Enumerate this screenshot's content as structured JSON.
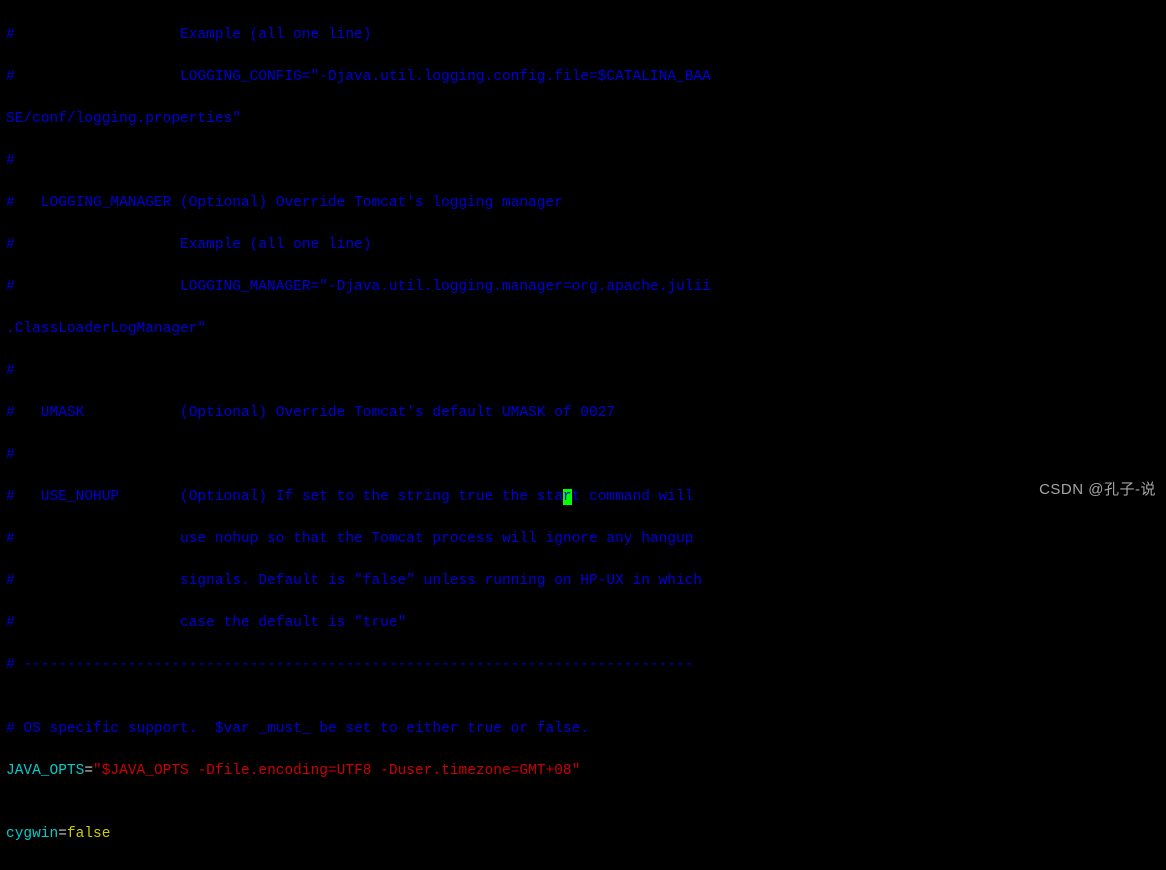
{
  "lines": {
    "l01": "#                   Example (all one line)",
    "l02": "#                   LOGGING_CONFIG=\"-Djava.util.logging.config.file=$CATALINA_BAA",
    "l03": "SE/conf/logging.properties\"",
    "l04": "#",
    "l05": "#   LOGGING_MANAGER (Optional) Override Tomcat's logging manager",
    "l06": "#                   Example (all one line)",
    "l07": "#                   LOGGING_MANAGER=\"-Djava.util.logging.manager=org.apache.julii",
    "l08": ".ClassLoaderLogManager\"",
    "l09": "#",
    "l10": "#   UMASK           (Optional) Override Tomcat's default UMASK of 0027",
    "l11": "#",
    "l12a": "#   USE_NOHUP       (Optional) If set to the string true the sta",
    "l12cursor": "r",
    "l12b": "t command will",
    "l13": "#                   use nohup so that the Tomcat process will ignore any hangup",
    "l14": "#                   signals. Default is \"false\" unless running on HP-UX in which",
    "l15": "#                   case the default is \"true\"",
    "l16": "# -----------------------------------------------------------------------------",
    "l17": "",
    "l18": "# OS specific support.  $var _must_ be set to either true or false.",
    "java_var": "JAVA_OPTS",
    "java_eq": "=",
    "java_q1": "\"",
    "java_inner": "$JAVA_OPTS",
    "java_opts_rest": " -Dfile.encoding=UTF8 -Duser.timezone=GMT+08",
    "java_q2": "\"",
    "l20": "",
    "cyg_var": "cygwin",
    "cyg_eq": "=",
    "cyg_val": "false"
  },
  "watermark": "CSDN @孔子-说"
}
